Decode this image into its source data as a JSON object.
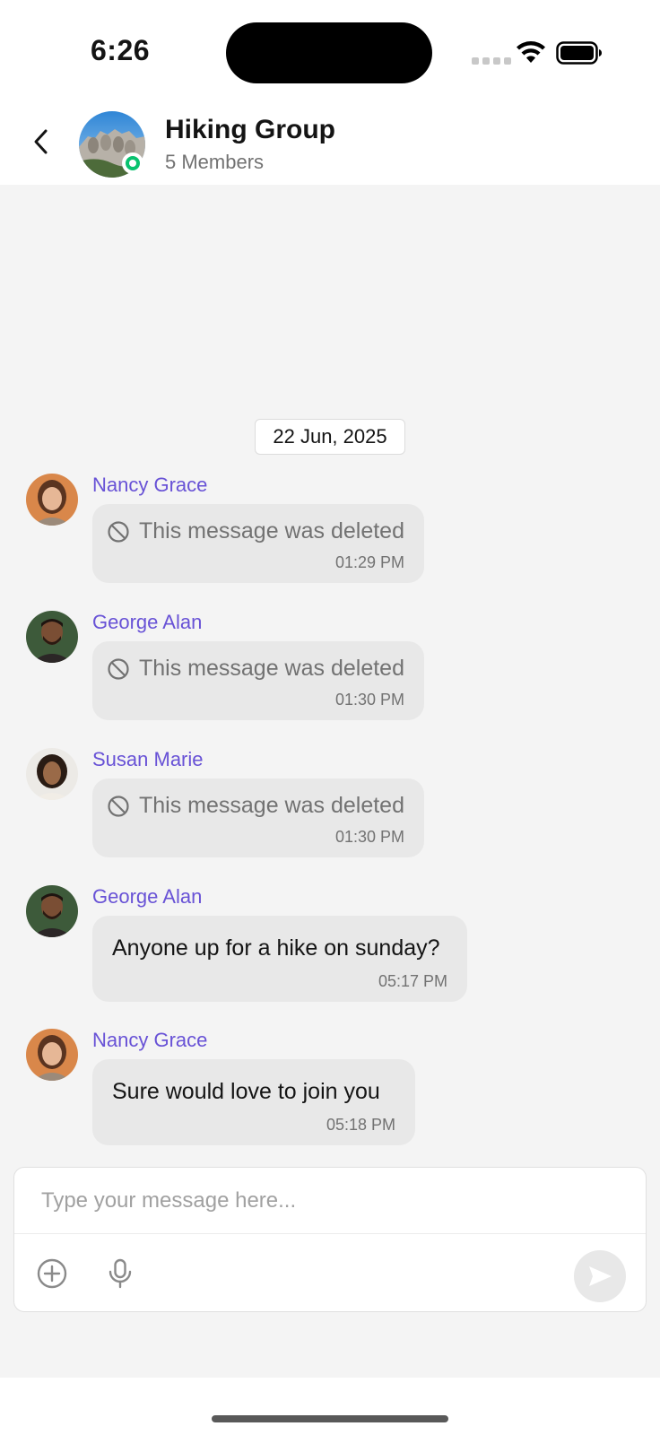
{
  "status_bar": {
    "time": "6:26"
  },
  "header": {
    "group_name": "Hiking Group",
    "member_count": "5 Members"
  },
  "date_separator": "22 Jun, 2025",
  "messages": [
    {
      "sender": "Nancy Grace",
      "text": "This message was deleted",
      "time": "01:29 PM",
      "deleted": true
    },
    {
      "sender": "George Alan",
      "text": "This message was deleted",
      "time": "01:30 PM",
      "deleted": true
    },
    {
      "sender": "Susan Marie",
      "text": "This message was deleted",
      "time": "01:30 PM",
      "deleted": true
    },
    {
      "sender": "George Alan",
      "text": "Anyone up for a hike on sunday?",
      "time": "05:17 PM",
      "deleted": false
    },
    {
      "sender": "Nancy Grace",
      "text": "Sure would love to join you",
      "time": "05:18 PM",
      "deleted": false
    }
  ],
  "composer": {
    "placeholder": "Type your message here..."
  },
  "colors": {
    "accent": "#6852d6",
    "online": "#09c26f",
    "bubble": "#e8e8e8",
    "background": "#f4f4f4"
  },
  "icons": [
    "chevron-left-icon",
    "ban-icon",
    "plus-circle-icon",
    "microphone-icon",
    "send-icon",
    "wifi-icon",
    "battery-icon"
  ]
}
